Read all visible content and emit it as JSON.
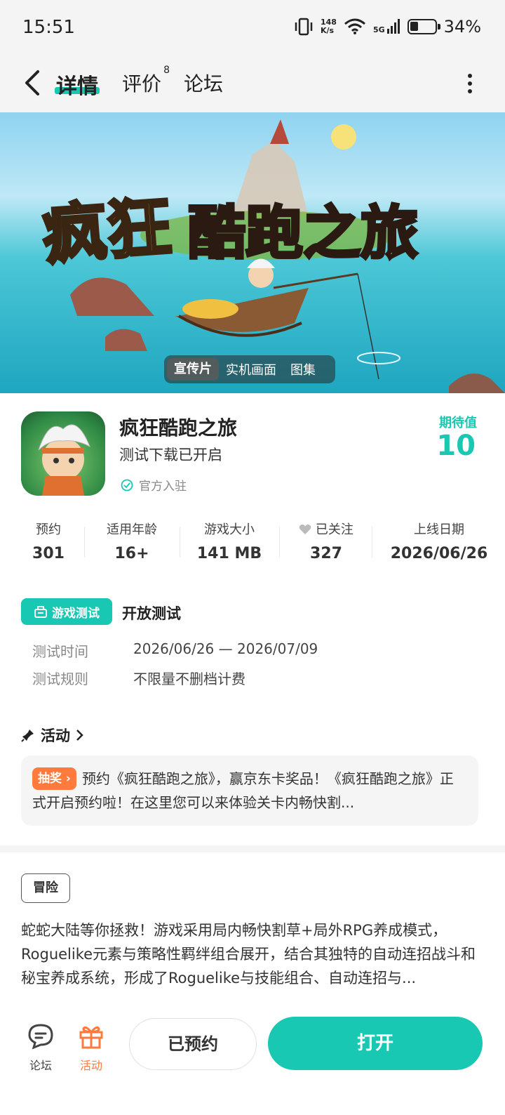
{
  "status_bar": {
    "time": "15:51",
    "net_speed_top": "148",
    "net_speed_bottom": "K/s",
    "network": "5G",
    "battery": "34%",
    "battery_level": 0.34
  },
  "nav": {
    "tabs": [
      {
        "label": "详情",
        "active": true
      },
      {
        "label": "评价",
        "badge": "8"
      },
      {
        "label": "论坛"
      }
    ]
  },
  "banner": {
    "title_part1": "疯狂",
    "title_part2": "酷跑之旅",
    "media_tabs": [
      "宣传片",
      "实机画面",
      "图集"
    ]
  },
  "app": {
    "name": "疯狂酷跑之旅",
    "subtitle": "测试下载已开启",
    "official": "官方入驻",
    "expect_label": "期待值",
    "expect_value": "10"
  },
  "stats": [
    {
      "label": "预约",
      "value": "301"
    },
    {
      "label": "适用年龄",
      "value": "16+"
    },
    {
      "label": "游戏大小",
      "value": "141 MB"
    },
    {
      "label": "已关注",
      "value": "327"
    },
    {
      "label": "上线日期",
      "value": "2026/06/26"
    }
  ],
  "test": {
    "badge": "游戏测试",
    "title": "开放测试",
    "rows": [
      {
        "label": "测试时间",
        "value": "2026/06/26 — 2026/07/09"
      },
      {
        "label": "测试规则",
        "value": "不限量不删档计费"
      }
    ]
  },
  "activity": {
    "header": "活动",
    "tag": "抽奖",
    "text": "预约《疯狂酷跑之旅》，赢京东卡奖品！《疯狂酷跑之旅》正式开启预约啦！在这里您可以来体验关卡内畅快割..."
  },
  "genre": "冒险",
  "description": "蛇蛇大陆等你拯救！游戏采用局内畅快割草+局外RPG养成模式，Roguelike元素与策略性羁绊组合展开，结合其独特的自动连招战斗和秘宝养成系统，形成了Roguelike与技能组合、自动连招与...",
  "bottom_bar": {
    "forum_label": "论坛",
    "activity_label": "活动",
    "reserved_label": "已预约",
    "open_label": "打开"
  },
  "colors": {
    "accent": "#18c8b2",
    "orange": "#ff7a3d"
  }
}
